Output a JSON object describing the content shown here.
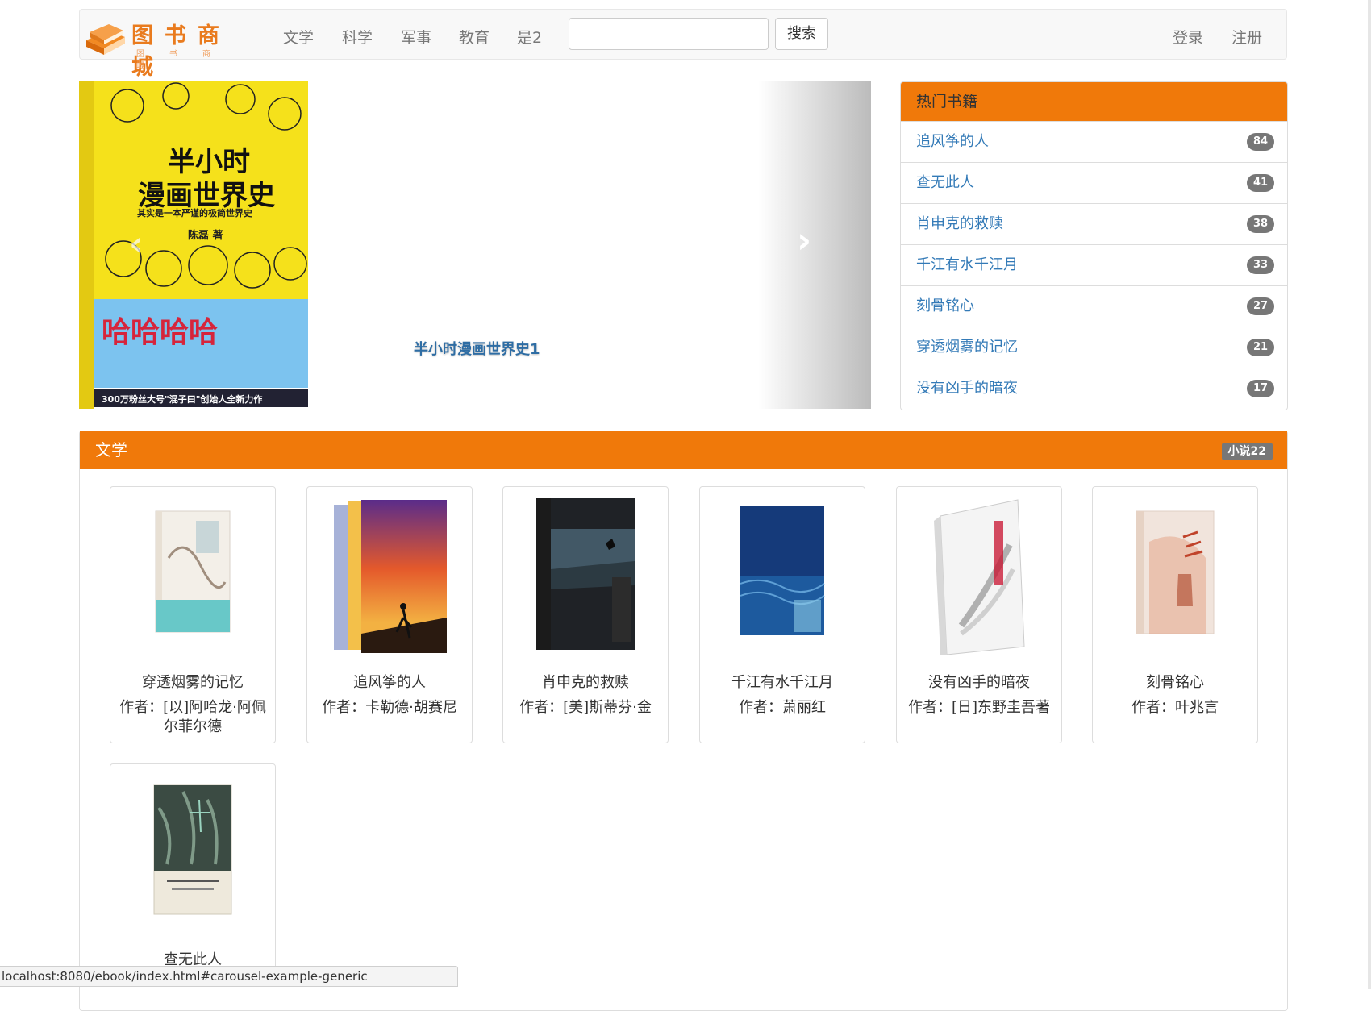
{
  "brand": {
    "title": "图书商城",
    "subtitle": "图书商城"
  },
  "nav": {
    "items": [
      "文学",
      "科学",
      "军事",
      "教育",
      "是2"
    ],
    "search_placeholder": "",
    "search_button": "搜索",
    "login": "登录",
    "register": "注册"
  },
  "carousel": {
    "caption": "半小时漫画世界史1",
    "cover": {
      "title_line1": "半小时",
      "title_line2": "漫画世界史",
      "subtitle": "其实是一本严谨的极简世界史",
      "author": "陈磊 著",
      "banner": "哈哈哈哈",
      "footer": "300万粉丝大号\"混子曰\"创始人全新力作"
    }
  },
  "hot": {
    "title": "热门书籍",
    "items": [
      {
        "name": "追风筝的人",
        "count": "84"
      },
      {
        "name": "查无此人",
        "count": "41"
      },
      {
        "name": "肖申克的救赎",
        "count": "38"
      },
      {
        "name": "千江有水千江月",
        "count": "33"
      },
      {
        "name": "刻骨铭心",
        "count": "27"
      },
      {
        "name": "穿透烟雾的记忆",
        "count": "21"
      },
      {
        "name": "没有凶手的暗夜",
        "count": "17"
      }
    ]
  },
  "literature": {
    "title": "文学",
    "badge": "小说22",
    "books": [
      {
        "title": "穿透烟雾的记忆",
        "author": "作者：[以]阿哈龙·阿佩尔菲尔德"
      },
      {
        "title": "追风筝的人",
        "author": "作者：卡勒德·胡赛尼"
      },
      {
        "title": "肖申克的救赎",
        "author": "作者：[美]斯蒂芬·金"
      },
      {
        "title": "千江有水千江月",
        "author": "作者：萧丽红"
      },
      {
        "title": "没有凶手的暗夜",
        "author": "作者：[日]东野圭吾著"
      },
      {
        "title": "刻骨铭心",
        "author": "作者：叶兆言"
      },
      {
        "title": "查无此人",
        "author": ""
      }
    ]
  },
  "status_url": "localhost:8080/ebook/index.html#carousel-example-generic",
  "colors": {
    "accent": "#f0790a",
    "link": "#337ab7",
    "badge": "#777777"
  }
}
